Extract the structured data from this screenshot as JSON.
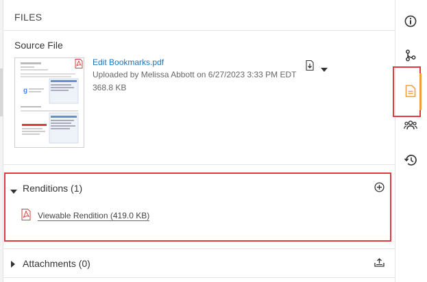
{
  "panel": {
    "title": "FILES"
  },
  "source_file": {
    "section_title": "Source File",
    "file_name": "Edit Bookmarks.pdf",
    "uploaded_text": "Uploaded by Melissa Abbott on 6/27/2023 3:33 PM EDT",
    "file_size": "368.8 KB",
    "download_icon": "download-icon",
    "menu_icon": "caret-down-icon"
  },
  "renditions": {
    "title": "Renditions (1)",
    "add_icon": "add-circle-icon",
    "items": [
      {
        "label": "Viewable Rendition (419.0 KB)",
        "icon": "pdf-icon"
      }
    ]
  },
  "attachments": {
    "title": "Attachments (0)",
    "upload_icon": "upload-icon"
  },
  "rail": {
    "items": [
      {
        "icon": "info-icon",
        "active": false
      },
      {
        "icon": "workflow-icon",
        "active": false
      },
      {
        "icon": "document-icon",
        "active": true
      },
      {
        "icon": "users-icon",
        "active": false
      },
      {
        "icon": "history-icon",
        "active": false
      }
    ]
  },
  "colors": {
    "link": "#1a73b8",
    "pdf_red": "#d83b3b",
    "active_accent": "#f0a03a",
    "highlight_border": "#e0393c"
  }
}
